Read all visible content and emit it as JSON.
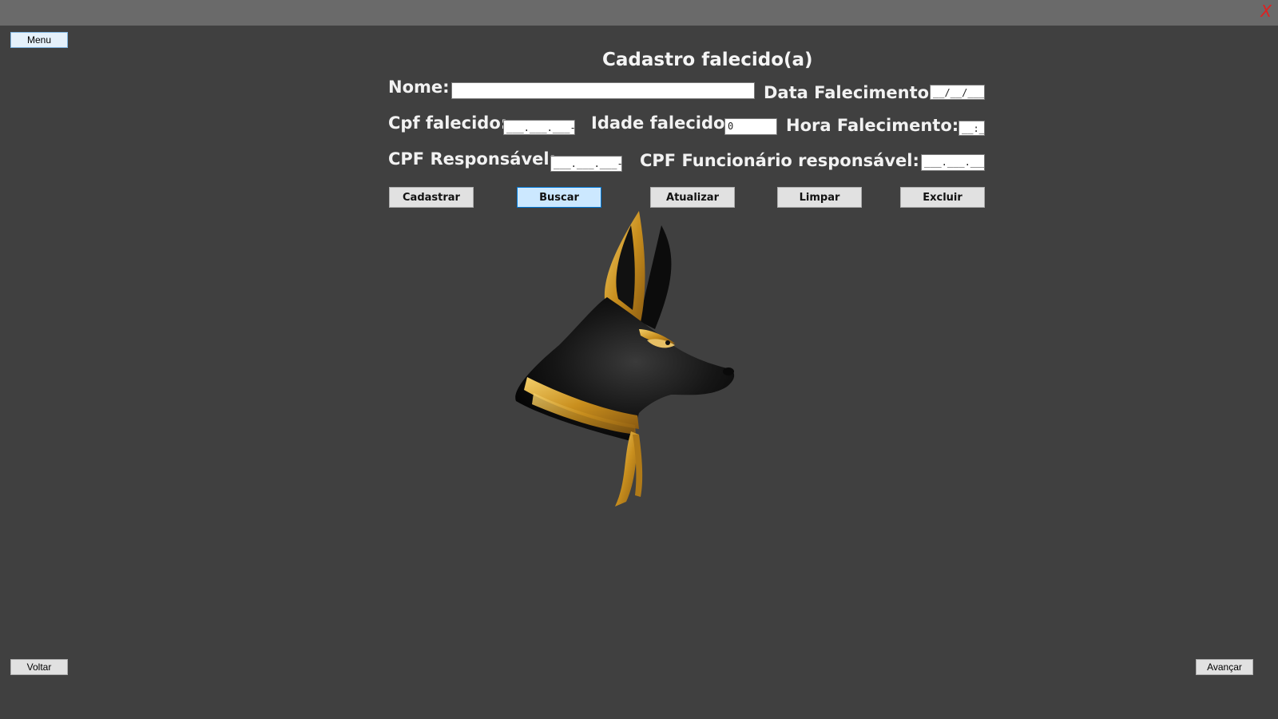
{
  "window": {
    "close_label": "X"
  },
  "nav": {
    "menu_label": "Menu",
    "back_label": "Voltar",
    "next_label": "Avançar"
  },
  "form": {
    "title": "Cadastro falecido(a)",
    "nome_label": "Nome:",
    "nome_value": "",
    "data_falecimento_label": "Data Falecimento:",
    "data_falecimento_value": "__/__/____",
    "cpf_falecido_label": "Cpf falecido:",
    "cpf_falecido_value": "___.___.___-__",
    "idade_label": "Idade falecido:",
    "idade_value": "0",
    "hora_label": "Hora Falecimento:",
    "hora_value": "__:__",
    "cpf_responsavel_label": "CPF Responsável:",
    "cpf_responsavel_value": "___.___.___-__",
    "cpf_funcionario_label": "CPF Funcionário responsável:",
    "cpf_funcionario_value": "___.___.___-__"
  },
  "actions": {
    "cadastrar": "Cadastrar",
    "buscar": "Buscar",
    "atualizar": "Atualizar",
    "limpar": "Limpar",
    "excluir": "Excluir"
  },
  "logo": {
    "icon": "anubis-head-icon"
  },
  "colors": {
    "background": "#404040",
    "titlebar": "#6a6a6a",
    "close": "#e02020",
    "gold": "#d4a02a",
    "active_button": "#cce8ff"
  }
}
